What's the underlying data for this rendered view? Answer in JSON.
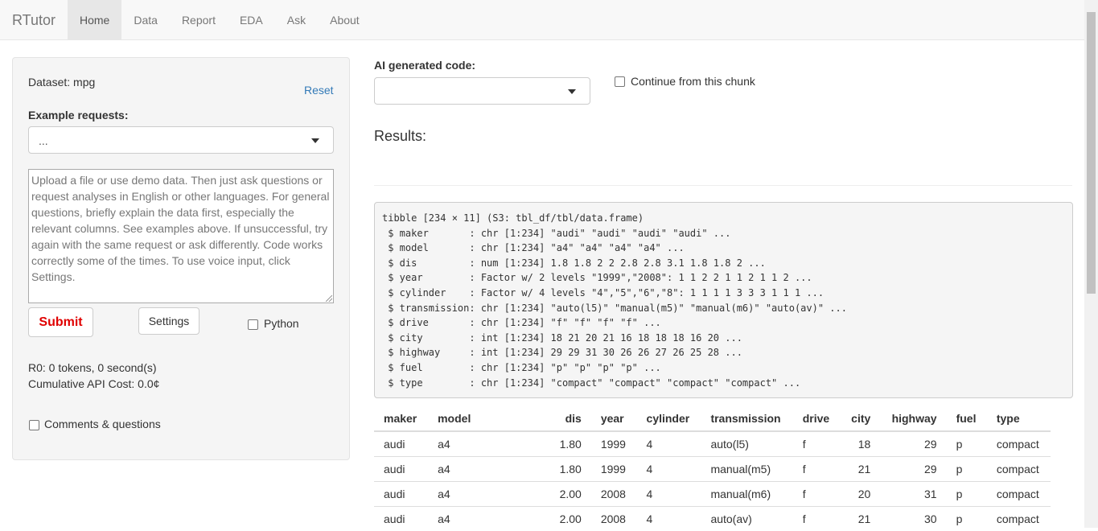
{
  "navbar": {
    "brand": "RTutor",
    "tabs": [
      {
        "label": "Home"
      },
      {
        "label": "Data"
      },
      {
        "label": "Report"
      },
      {
        "label": "EDA"
      },
      {
        "label": "Ask"
      },
      {
        "label": "About"
      }
    ],
    "active_tab": "Home"
  },
  "sidebar": {
    "dataset_label": "Dataset: mpg",
    "reset_label": "Reset",
    "example_label": "Example requests:",
    "example_selected": "...",
    "request_placeholder": "Upload a file or use demo data. Then just ask questions or request analyses in English or other languages. For general questions, briefly explain the data first, especially the relevant columns. See examples above. If unsuccessful, try again with the same request or ask differently. Code works correctly some of the times. To use voice input, click Settings.",
    "submit_label": "Submit",
    "settings_label": "Settings",
    "python_label": "Python",
    "tokens_text": "R0: 0 tokens, 0 second(s)",
    "cost_text": "Cumulative API Cost: 0.0¢",
    "comments_label": "Comments & questions"
  },
  "main": {
    "ai_code_label": "AI generated code:",
    "ai_code_selected": "",
    "continue_label": "Continue from this chunk",
    "results_label": "Results:",
    "str_output": [
      "tibble [234 × 11] (S3: tbl_df/tbl/data.frame)",
      " $ maker       : chr [1:234] \"audi\" \"audi\" \"audi\" \"audi\" ...",
      " $ model       : chr [1:234] \"a4\" \"a4\" \"a4\" \"a4\" ...",
      " $ dis         : num [1:234] 1.8 1.8 2 2 2.8 2.8 3.1 1.8 1.8 2 ...",
      " $ year        : Factor w/ 2 levels \"1999\",\"2008\": 1 1 2 2 1 1 2 1 1 2 ...",
      " $ cylinder    : Factor w/ 4 levels \"4\",\"5\",\"6\",\"8\": 1 1 1 1 3 3 3 1 1 1 ...",
      " $ transmission: chr [1:234] \"auto(l5)\" \"manual(m5)\" \"manual(m6)\" \"auto(av)\" ...",
      " $ drive       : chr [1:234] \"f\" \"f\" \"f\" \"f\" ...",
      " $ city        : int [1:234] 18 21 20 21 16 18 18 18 16 20 ...",
      " $ highway     : int [1:234] 29 29 31 30 26 26 27 26 25 28 ...",
      " $ fuel        : chr [1:234] \"p\" \"p\" \"p\" \"p\" ...",
      " $ type        : chr [1:234] \"compact\" \"compact\" \"compact\" \"compact\" ..."
    ],
    "table": {
      "headers": [
        "maker",
        "model",
        "dis",
        "year",
        "cylinder",
        "transmission",
        "drive",
        "city",
        "highway",
        "fuel",
        "type"
      ],
      "rows": [
        [
          "audi",
          "a4",
          "1.80",
          "1999",
          "4",
          "auto(l5)",
          "f",
          "18",
          "29",
          "p",
          "compact"
        ],
        [
          "audi",
          "a4",
          "1.80",
          "1999",
          "4",
          "manual(m5)",
          "f",
          "21",
          "29",
          "p",
          "compact"
        ],
        [
          "audi",
          "a4",
          "2.00",
          "2008",
          "4",
          "manual(m6)",
          "f",
          "20",
          "31",
          "p",
          "compact"
        ],
        [
          "audi",
          "a4",
          "2.00",
          "2008",
          "4",
          "auto(av)",
          "f",
          "21",
          "30",
          "p",
          "compact"
        ]
      ]
    }
  }
}
